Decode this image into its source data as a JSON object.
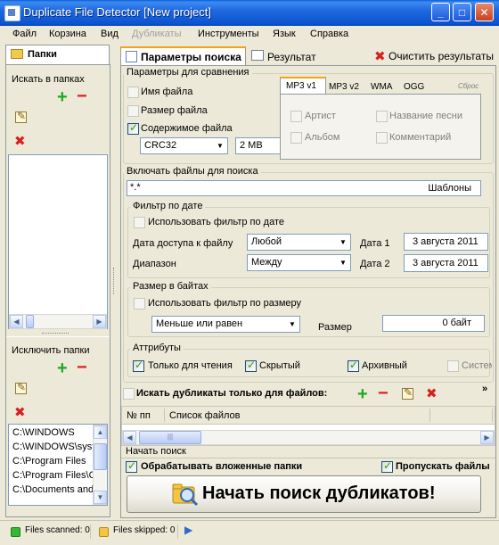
{
  "window": {
    "title": "Duplicate File Detector [New project]",
    "minimize": "_",
    "maximize": "□",
    "close": "✕"
  },
  "menu": [
    "Файл",
    "Корзина",
    "Вид",
    "Дубликаты",
    "Инструменты",
    "Язык",
    "Справка"
  ],
  "left_panel": {
    "tab_label": "Папки",
    "search_folders_label": "Искать в папках",
    "exclude_folders_label": "Исключить папки",
    "excluded_folders": [
      "C:\\WINDOWS",
      "C:\\WINDOWS\\syst",
      "C:\\Program Files",
      "C:\\Program Files\\C",
      "C:\\Documents and"
    ]
  },
  "tabs": {
    "search_params": "Параметры поиска",
    "results": "Результат",
    "clear_results": "Очистить результаты"
  },
  "compare": {
    "title": "Параметры для сравнения",
    "file_name": "Имя файла",
    "file_size": "Размер файла",
    "file_content": "Содержимое файла",
    "algorithm": "CRC32",
    "block_size": "2 MB",
    "tag_tabs": [
      "MP3 v1",
      "MP3 v2",
      "WMA",
      "OGG"
    ],
    "reset": "Сброс",
    "artist": "Артист",
    "album": "Альбом",
    "song_title": "Название песни",
    "comment": "Комментарий"
  },
  "include": {
    "title": "Включать файлы для поиска",
    "mask": "*.*",
    "templates": "Шаблоны"
  },
  "date_filter": {
    "title": "Фильтр по дате",
    "use_filter": "Использовать фильтр по дате",
    "access_date_label": "Дата доступа к файлу",
    "access_date_value": "Любой",
    "range_label": "Диапазон",
    "range_value": "Между",
    "date1_label": "Дата 1",
    "date1_value": "3  августа  2011",
    "date2_label": "Дата 2",
    "date2_value": "3  августа  2011"
  },
  "size_filter": {
    "title": "Размер в байтах",
    "use_filter": "Использовать фильтр по размеру",
    "comparison": "Меньше или равен",
    "size_label": "Размер",
    "size_value": "0 байт"
  },
  "attributes": {
    "title": "Аттрибуты",
    "readonly": "Только для чтения",
    "hidden": "Скрытый",
    "archive": "Архивный",
    "system": "Системный"
  },
  "duplicates_only": {
    "label": "Искать дубликаты только для файлов:",
    "more": "»",
    "col_no": "№ пп",
    "col_list": "Список файлов"
  },
  "start": {
    "title": "Начать поиск",
    "process_subfolders": "Обрабатывать вложенные папки",
    "skip_files": "Пропускать файлы",
    "button": "Начать поиск дубликатов!"
  },
  "status": {
    "scanned": "Files scanned: 0",
    "skipped": "Files skipped: 0"
  }
}
